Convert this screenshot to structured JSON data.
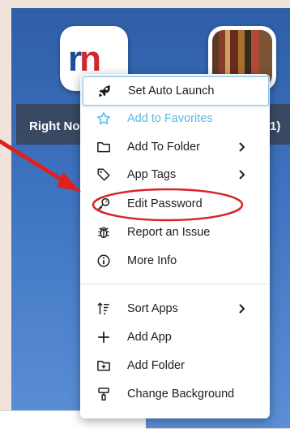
{
  "background": {
    "tiles": [
      {
        "name": "rn",
        "letters_1": "r",
        "letters_2": "n"
      }
    ],
    "label_left": "Right No",
    "label_right": "1)"
  },
  "menu": {
    "items": [
      {
        "label": "Set Auto Launch",
        "icon": "rocket-icon"
      },
      {
        "label": "Add to Favorites",
        "icon": "star-icon"
      },
      {
        "label": "Add To Folder",
        "icon": "folder-icon",
        "submenu": true
      },
      {
        "label": "App Tags",
        "icon": "tag-icon",
        "submenu": true
      },
      {
        "label": "Edit Password",
        "icon": "key-icon"
      },
      {
        "label": "Report an Issue",
        "icon": "bug-icon"
      },
      {
        "label": "More Info",
        "icon": "info-icon"
      },
      {
        "label": "Sort Apps",
        "icon": "sort-icon",
        "submenu": true
      },
      {
        "label": "Add App",
        "icon": "plus-icon"
      },
      {
        "label": "Add Folder",
        "icon": "add-folder-icon"
      },
      {
        "label": "Change Background",
        "icon": "paint-roller-icon"
      }
    ]
  },
  "annotations": {
    "arrow_color": "#e0201b",
    "ellipse_color": "#d7252a",
    "highlight_color": "#8ac4e8"
  }
}
